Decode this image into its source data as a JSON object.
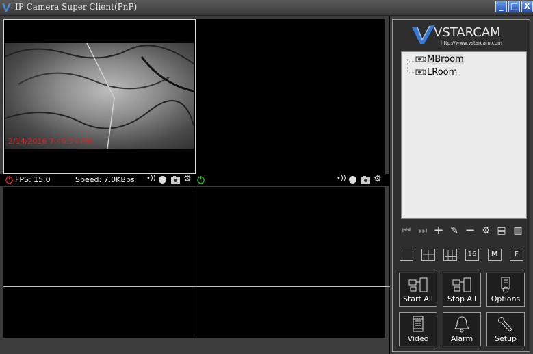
{
  "window": {
    "title": "IP Camera Super Client(PnP)",
    "minimize": "_",
    "maximize": "□",
    "close": "X"
  },
  "video": {
    "timestamp": "2/14/2016 7:46:34 PM",
    "pane1": {
      "fps_label": "FPS: 15.0",
      "speed_label": "Speed: 7.0KBps"
    }
  },
  "sidebar": {
    "logo": {
      "brand": "VSTARCAM",
      "url": "http://www.vstarcam.com"
    },
    "devices": [
      {
        "name": "MBroom",
        "selected": true
      },
      {
        "name": "LRoom",
        "selected": false
      }
    ],
    "layouts": {
      "split16": "16",
      "multi": "M",
      "full": "F"
    },
    "buttons": {
      "start_all": "Start All",
      "stop_all": "Stop All",
      "options": "Options",
      "video": "Video",
      "alarm": "Alarm",
      "setup": "Setup"
    }
  },
  "colors": {
    "timestamp": "#e02020",
    "accent": "#2850b8",
    "power_off": "#e02020",
    "power_on": "#20c020"
  }
}
